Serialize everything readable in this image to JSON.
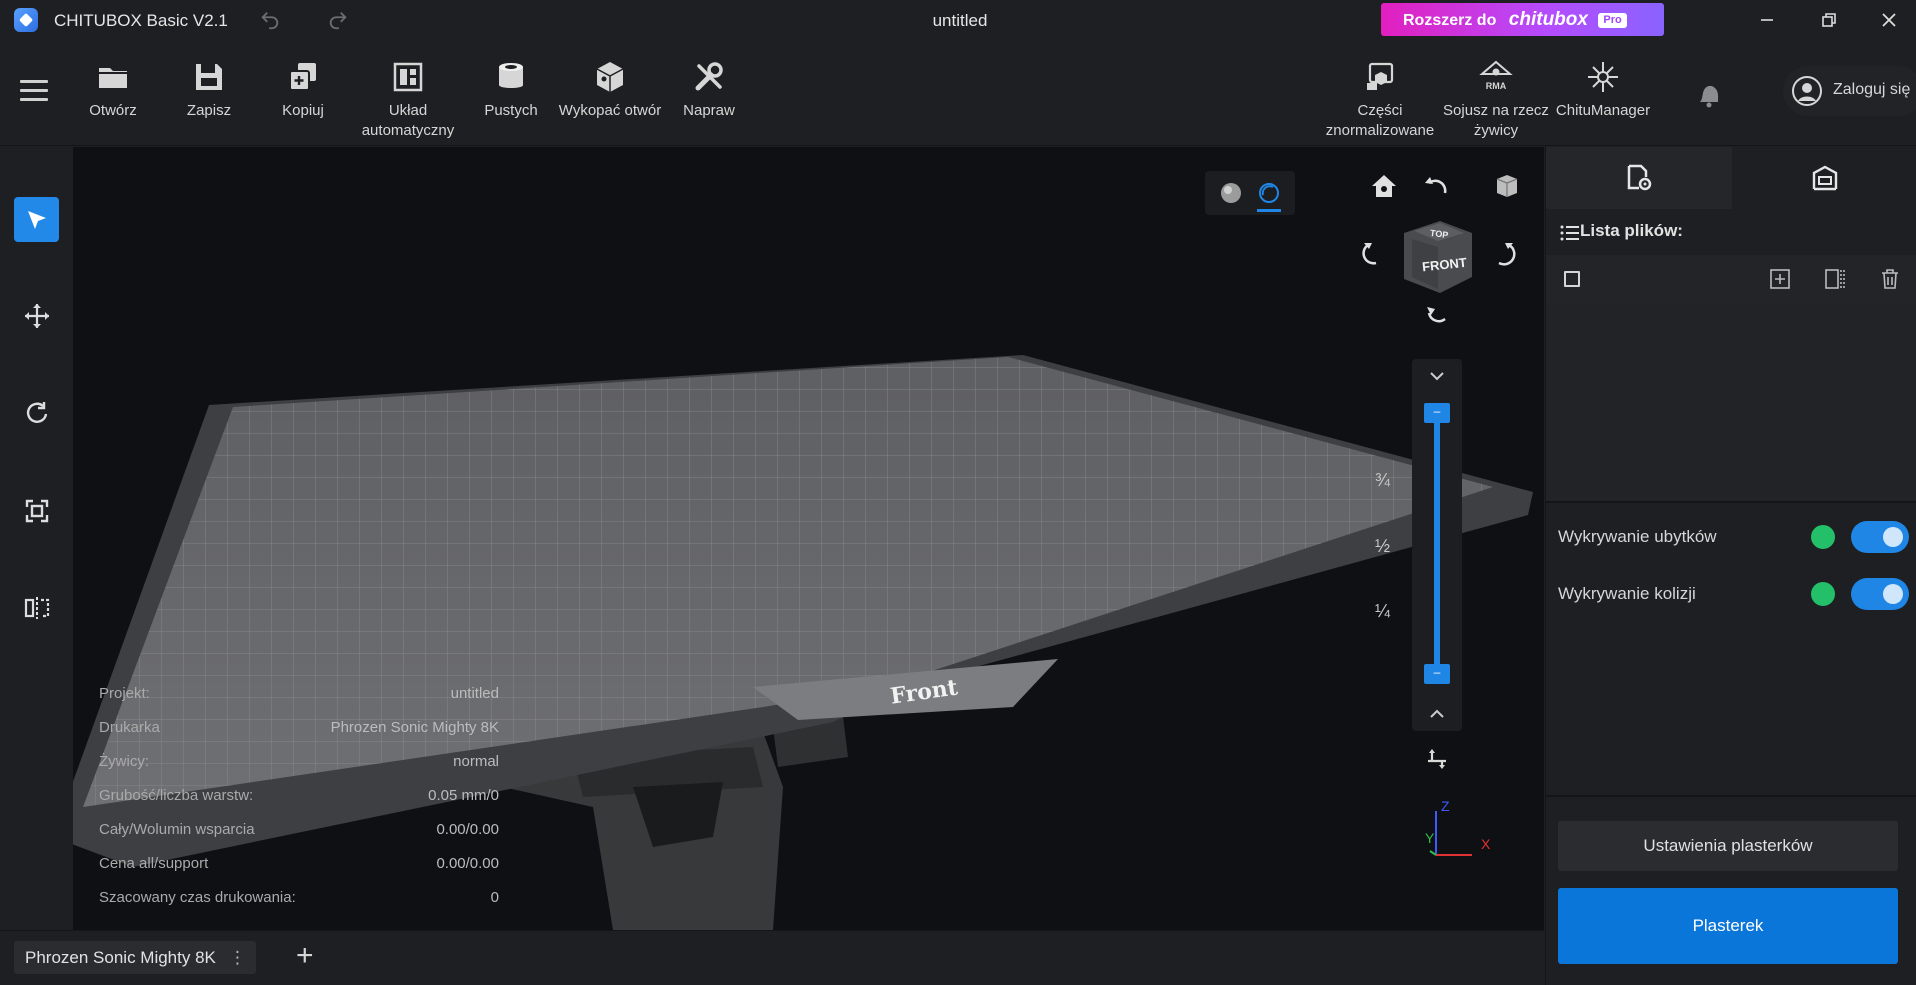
{
  "titlebar": {
    "app_title": "CHITUBOX Basic V2.1",
    "doc_title": "untitled",
    "upgrade": {
      "prefix": "Rozszerz do",
      "brand": "chitubox",
      "badge": "Pro"
    },
    "window_controls": [
      "minimize-icon",
      "restore-icon",
      "close-icon"
    ]
  },
  "toolbar": {
    "tools": [
      {
        "label": "Otwórz",
        "icon": "folder-icon"
      },
      {
        "label": "Zapisz",
        "icon": "save-icon"
      },
      {
        "label": "Kopiuj",
        "icon": "copy-icon"
      },
      {
        "label": "Układ automatyczny",
        "icon": "auto-layout-icon"
      },
      {
        "label": "Pustych",
        "icon": "hollow-icon"
      },
      {
        "label": "Wykopać otwór",
        "icon": "dig-hole-icon"
      },
      {
        "label": "Napraw",
        "icon": "repair-icon"
      }
    ],
    "right_tools": [
      {
        "label": "Części znormalizowane",
        "icon": "parts-icon"
      },
      {
        "label": "Sojusz na rzecz żywicy",
        "icon": "rma-icon"
      },
      {
        "label": "ChituManager",
        "icon": "chitumanager-icon"
      }
    ],
    "login_label": "Zaloguj się"
  },
  "left_tools": [
    "select-icon",
    "move-icon",
    "rotate-icon",
    "scale-icon",
    "mirror-icon"
  ],
  "viewport": {
    "plate_label": "Front",
    "cube_front": "FRONT",
    "cube_top": "TOP",
    "fractions": [
      "¾",
      "½",
      "¼"
    ],
    "axes": {
      "x": "X",
      "y": "Y",
      "z": "Z"
    },
    "info": [
      {
        "key": "Projekt:",
        "value": "untitled"
      },
      {
        "key": "Drukarka",
        "value": "Phrozen Sonic Mighty 8K"
      },
      {
        "key": "Żywicy:",
        "value": "normal"
      },
      {
        "key": "Grubość/liczba warstw:",
        "value": "0.05 mm/0"
      },
      {
        "key": "Cały/Wolumin wsparcia",
        "value": "0.00/0.00"
      },
      {
        "key": "Cena all/support",
        "value": "0.00/0.00"
      },
      {
        "key": "Szacowany czas drukowania:",
        "value": "0"
      }
    ]
  },
  "right_panel": {
    "filelist_title": "Lista plików:",
    "detections": [
      {
        "label": "Wykrywanie ubytków",
        "enabled": true
      },
      {
        "label": "Wykrywanie kolizji",
        "enabled": true
      }
    ],
    "settings_button": "Ustawienia plasterków",
    "slice_button": "Plasterek"
  },
  "bottombar": {
    "printer_tab": "Phrozen Sonic Mighty 8K",
    "add_tab": "+"
  }
}
